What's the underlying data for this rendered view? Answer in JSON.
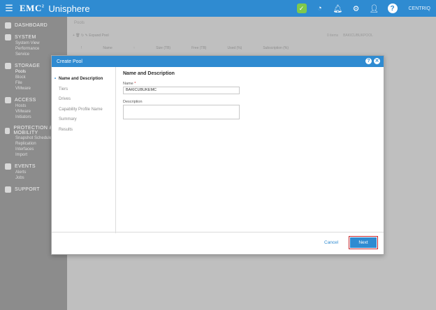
{
  "topbar": {
    "brand": "EMC",
    "brand_sup": "2",
    "app_name": "Unisphere",
    "logo_text": "CENTRIQ"
  },
  "sidebar": {
    "sections": [
      {
        "title": "DASHBOARD",
        "items": []
      },
      {
        "title": "SYSTEM",
        "items": [
          "System View",
          "Performance",
          "Service"
        ]
      },
      {
        "title": "STORAGE",
        "items": [
          "Pools",
          "Block",
          "File",
          "VMware"
        ]
      },
      {
        "title": "ACCESS",
        "items": [
          "Hosts",
          "VMware",
          "Initiators"
        ]
      },
      {
        "title": "PROTECTION & MOBILITY",
        "items": [
          "Snapshot Schedule",
          "Replication",
          "Interfaces",
          "Import"
        ]
      },
      {
        "title": "EVENTS",
        "items": [
          "Alerts",
          "Jobs"
        ]
      },
      {
        "title": "SUPPORT",
        "items": []
      }
    ]
  },
  "background": {
    "tab": "Pools",
    "toolbar": "+   🗑   ↻   ✎   Expand Pool",
    "columns": [
      "!",
      "Name",
      "↑",
      "Size (TB)",
      "Free (TB)",
      "Used (%)",
      "Subscription (%)"
    ],
    "items_count": "0 items",
    "right_panel_title": "BAKICUBUKPOOL"
  },
  "modal": {
    "title": "Create Pool",
    "steps": [
      "Name and Description",
      "Tiers",
      "Drives",
      "Capability Profile Name",
      "Summary",
      "Results"
    ],
    "section_title": "Name and Description",
    "name_label": "Name",
    "name_required_marker": "*",
    "name_value": "BAKICUBUKEMC",
    "description_label": "Description",
    "description_value": "",
    "cancel_label": "Cancel",
    "next_label": "Next"
  },
  "colors": {
    "accent": "#2f8bd1",
    "highlight": "#c8272d"
  }
}
